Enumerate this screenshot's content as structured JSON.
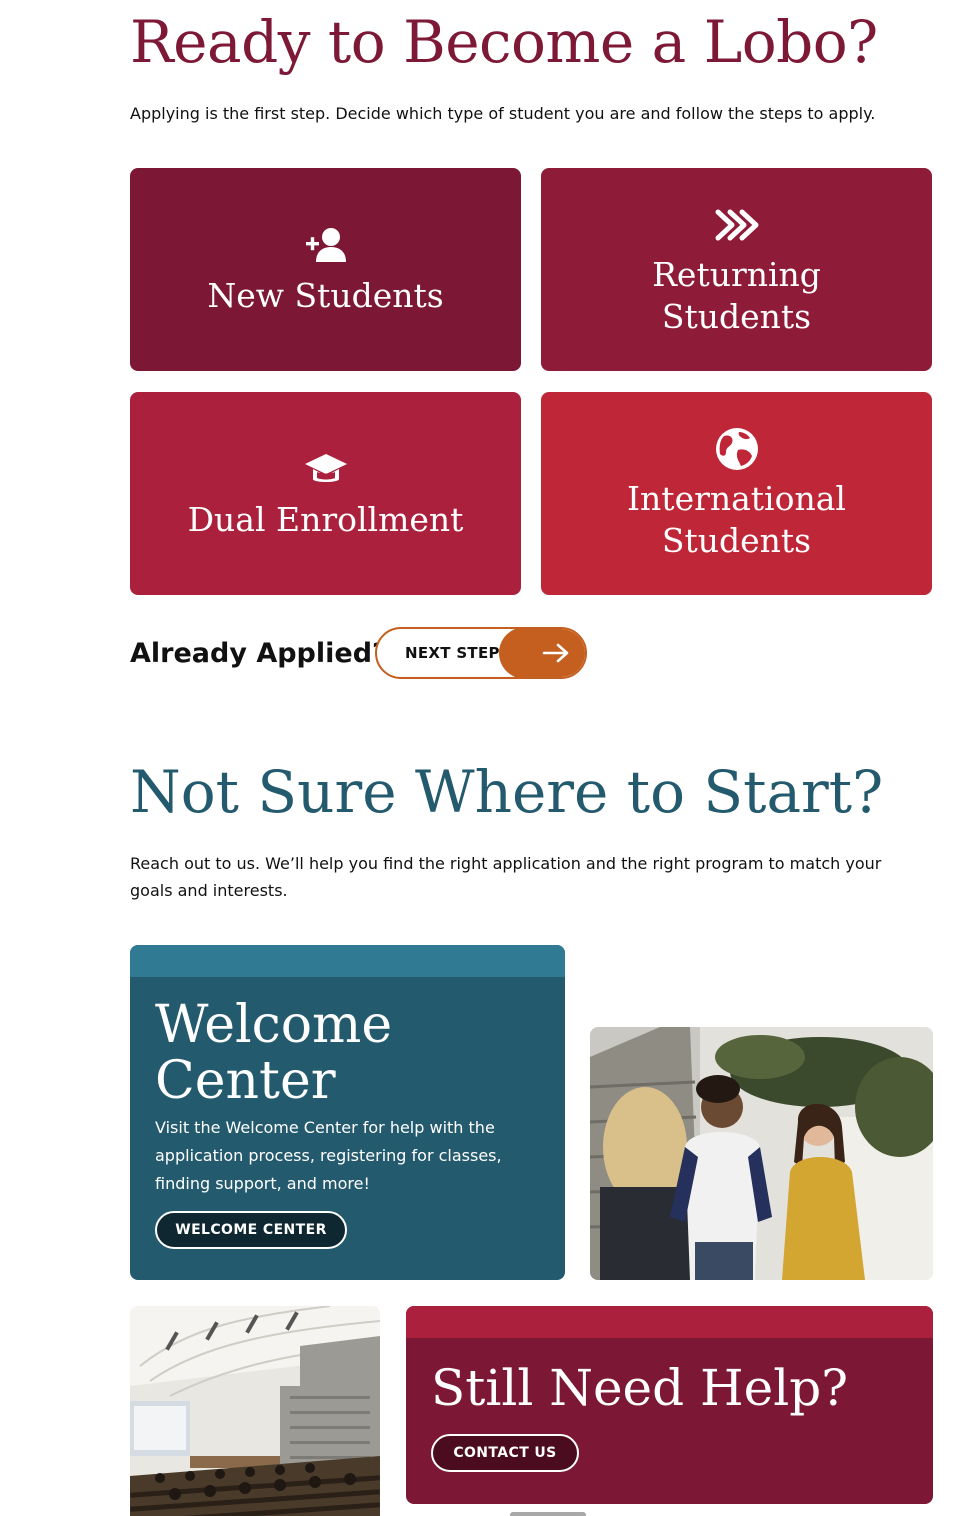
{
  "section_apply": {
    "title": "Ready to Become a Lobo?",
    "intro": "Applying is the first step. Decide which type of student you are and follow the steps to apply.",
    "tiles": [
      {
        "icon": "add-user-icon",
        "label": "New Students"
      },
      {
        "icon": "double-chevron-right-icon",
        "label": "Returning Students"
      },
      {
        "icon": "graduation-cap-icon",
        "label": "Dual Enrollment"
      },
      {
        "icon": "globe-icon",
        "label": "International Students"
      }
    ]
  },
  "already_applied": {
    "label": "Already Applied?",
    "button_label": "NEXT STEPS",
    "button_icon": "arrow-right-icon"
  },
  "section_start": {
    "title": "Not Sure Where to Start?",
    "intro": "Reach out to us. We’ll help you find the right application and the right program to match your goals and interests."
  },
  "welcome_card": {
    "title": "Welcome Center",
    "description": "Visit the Welcome Center for help with the application process, registering for classes, finding support, and more!",
    "button_label": "WELCOME CENTER"
  },
  "help_card": {
    "title": "Still Need Help?",
    "button_label": "CONTACT US"
  },
  "images": [
    {
      "name": "students-photo",
      "subject": "students-talking-outdoors"
    },
    {
      "name": "lecture-hall-photo",
      "subject": "lecture-hall-classroom"
    }
  ],
  "colors": {
    "burgundy": "#7c1736",
    "crimson": "#ab213d",
    "red": "#bf2637",
    "teal": "#245a6d",
    "orange": "#c55f1f"
  }
}
